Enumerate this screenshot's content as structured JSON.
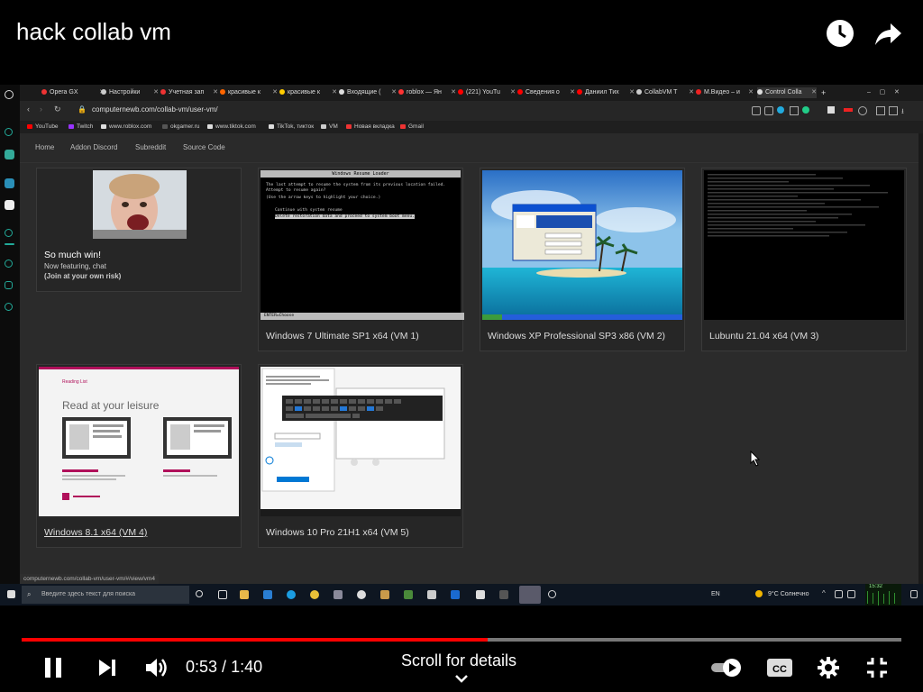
{
  "video": {
    "title": "hack collab vm",
    "time_current": "0:53",
    "time_sep": " / ",
    "time_total": "1:40",
    "progress": 0.53,
    "scroll_hint": "Scroll for details"
  },
  "browser": {
    "tabs": [
      {
        "label": "Opera GX"
      },
      {
        "label": "Настройки"
      },
      {
        "label": "Учетная зап"
      },
      {
        "label": "красивые к"
      },
      {
        "label": "красивые к"
      },
      {
        "label": "Входящие ("
      },
      {
        "label": "roblox — Ян"
      },
      {
        "label": "(221) YouTu"
      },
      {
        "label": "Сведения о"
      },
      {
        "label": "Даниил Тих"
      },
      {
        "label": "CollabVM T"
      },
      {
        "label": "М.Видео – и"
      },
      {
        "label": "Control Colla"
      }
    ],
    "url": "computernewb.com/collab-vm/user-vm/",
    "bookmarks": [
      "YouTube",
      "Twitch",
      "www.roblox.com",
      "okgamer.ru",
      "www.tiktok.com",
      "TikTok, тикток",
      "VM",
      "Новая вкладка",
      "Gmail"
    ],
    "status_url": "computernewb.com/collab-vm/user-vm/#/view/vm4"
  },
  "site": {
    "nav": [
      "Home",
      "Addon Discord",
      "Subreddit",
      "Source Code"
    ],
    "promo": {
      "headline": "So much win!",
      "sub": "Now featuring, chat",
      "warning": "(Join at your own risk)"
    },
    "vms": [
      {
        "label": "Windows 7 Ultimate SP1 x64 (VM 1)"
      },
      {
        "label": "Windows XP Professional SP3 x86 (VM 2)"
      },
      {
        "label": "Lubuntu 21.04 x64 (VM 3)"
      },
      {
        "label": "Windows 8.1 x64 (VM 4)"
      },
      {
        "label": "Windows 10 Pro 21H1 x64 (VM 5)"
      }
    ],
    "win7_boot": {
      "header": "Windows Resume Loader",
      "msg": "The last attempt to resume the system from its previous location failed. Attempt to resume again?",
      "hint": "(Use the arrow keys to highlight your choice.)",
      "opt1": "Continue with system resume",
      "opt2": "Delete restoration data and proceed to system boot menu.",
      "footer": "ENTER=Choose"
    },
    "win81_app": {
      "brand": "Reading List",
      "title": "Read at your leisure"
    }
  },
  "taskbar": {
    "search_placeholder": "Введите здесь текст для поиска",
    "lang": "EN",
    "weather": "9°C  Солнечно",
    "clock": "15:32"
  },
  "colors": {
    "progress": "#ff0000",
    "page_bg": "#2b2b2b",
    "accent_pink": "#b0105a"
  }
}
